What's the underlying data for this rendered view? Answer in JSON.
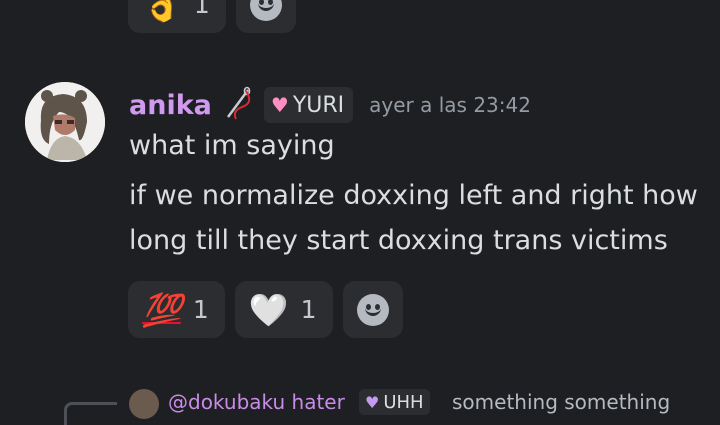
{
  "top_reactions": [
    {
      "emoji": "👌",
      "count": "1"
    }
  ],
  "message": {
    "username": "anika",
    "user_icon": "needle-and-thread-icon",
    "role_tag": {
      "icon": "heart-icon",
      "label": "YURI"
    },
    "timestamp": "ayer a las 23:42",
    "lines": [
      "what im saying",
      "if we normalize doxxing left and right how",
      "long till they start doxxing trans victims"
    ]
  },
  "reactions": [
    {
      "emoji": "💯",
      "count": "1"
    },
    {
      "emoji": "🤍",
      "count": "1"
    }
  ],
  "reply": {
    "username": "@dokubaku hater",
    "role_tag": "UHH",
    "text": "something something"
  },
  "colors": {
    "background": "#1e1f22",
    "username": "#d09af0",
    "reaction_bg": "#2b2d31"
  }
}
